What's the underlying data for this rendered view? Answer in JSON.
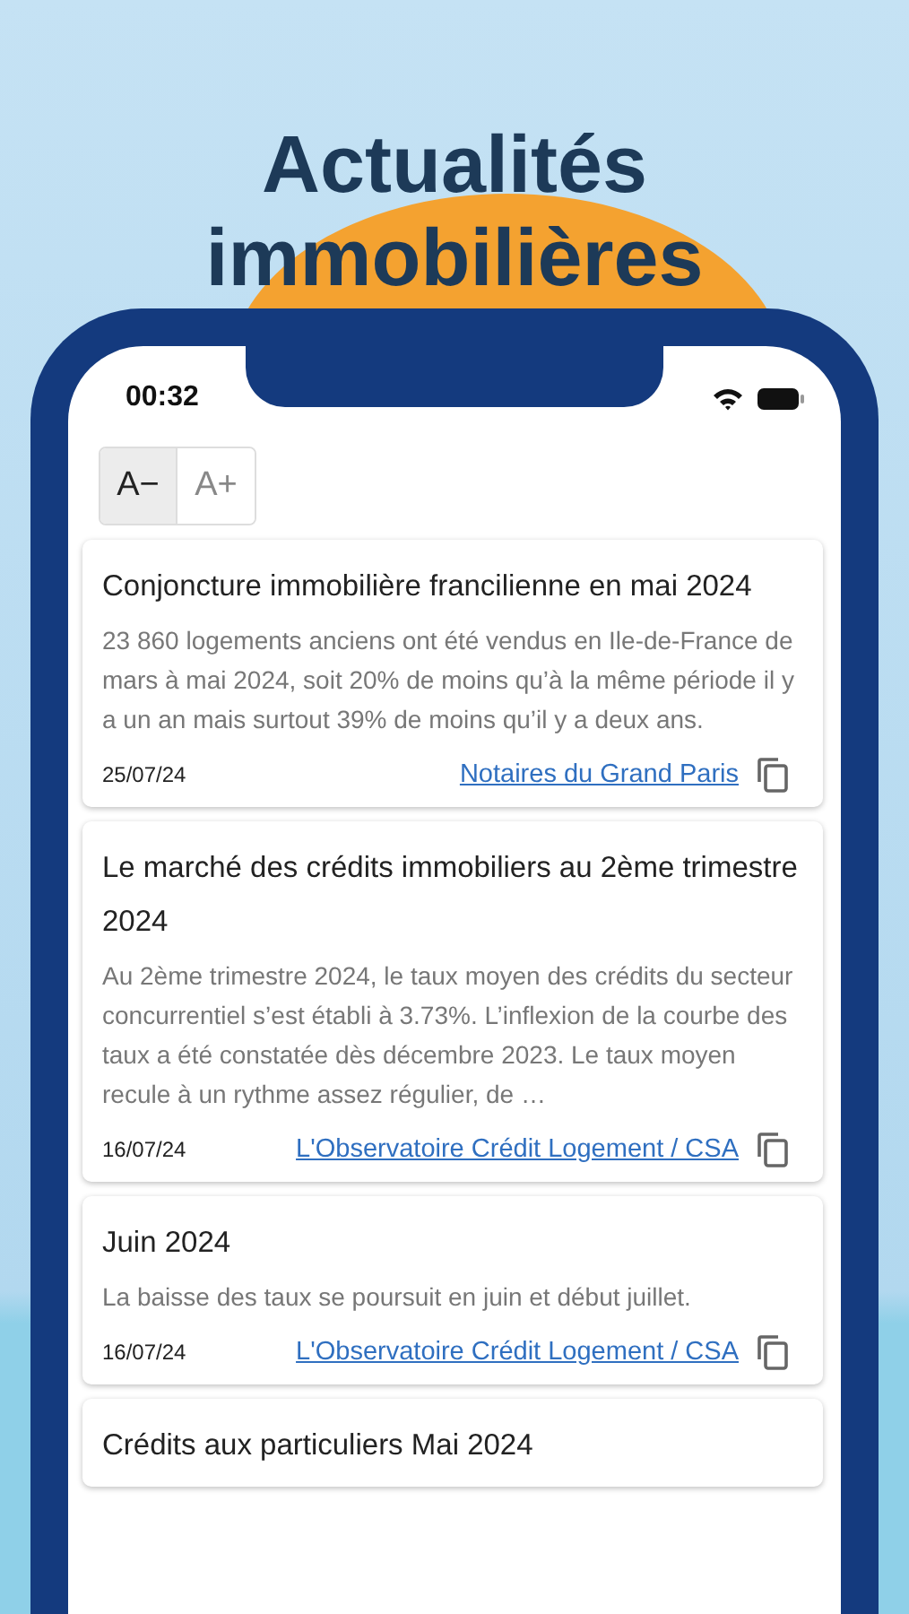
{
  "headline": [
    "Actualités",
    "immobilières"
  ],
  "status_bar": {
    "time": "00:32"
  },
  "font_size_buttons": [
    {
      "label": "A−",
      "selected": true
    },
    {
      "label": "A+",
      "selected": false
    }
  ],
  "articles": [
    {
      "title": "Conjoncture immobilière francilienne en mai 2024",
      "summary": "23 860 logements anciens ont été vendus en Ile-de-France de mars à mai 2024, soit 20% de moins qu’à la même période il y a un an mais surtout 39% de moins qu’il y a deux ans.",
      "date": "25/07/24",
      "source": "Notaires du Grand Paris"
    },
    {
      "title": "Le marché des crédits immobiliers au 2ème trimestre 2024",
      "summary": "Au 2ème trimestre 2024, le taux moyen des crédits du secteur concurrentiel s’est établi à 3.73%. L’inflexion de la courbe des taux a été constatée dès décembre 2023. Le taux moyen recule à un rythme assez régulier, de …",
      "date": "16/07/24",
      "source": "L'Observatoire Crédit Logement / CSA"
    },
    {
      "title": "Juin 2024",
      "summary": "La baisse des taux se poursuit en juin et début juillet.",
      "date": "16/07/24",
      "source": "L'Observatoire Crédit Logement / CSA"
    },
    {
      "title": "Crédits aux particuliers Mai 2024"
    }
  ]
}
